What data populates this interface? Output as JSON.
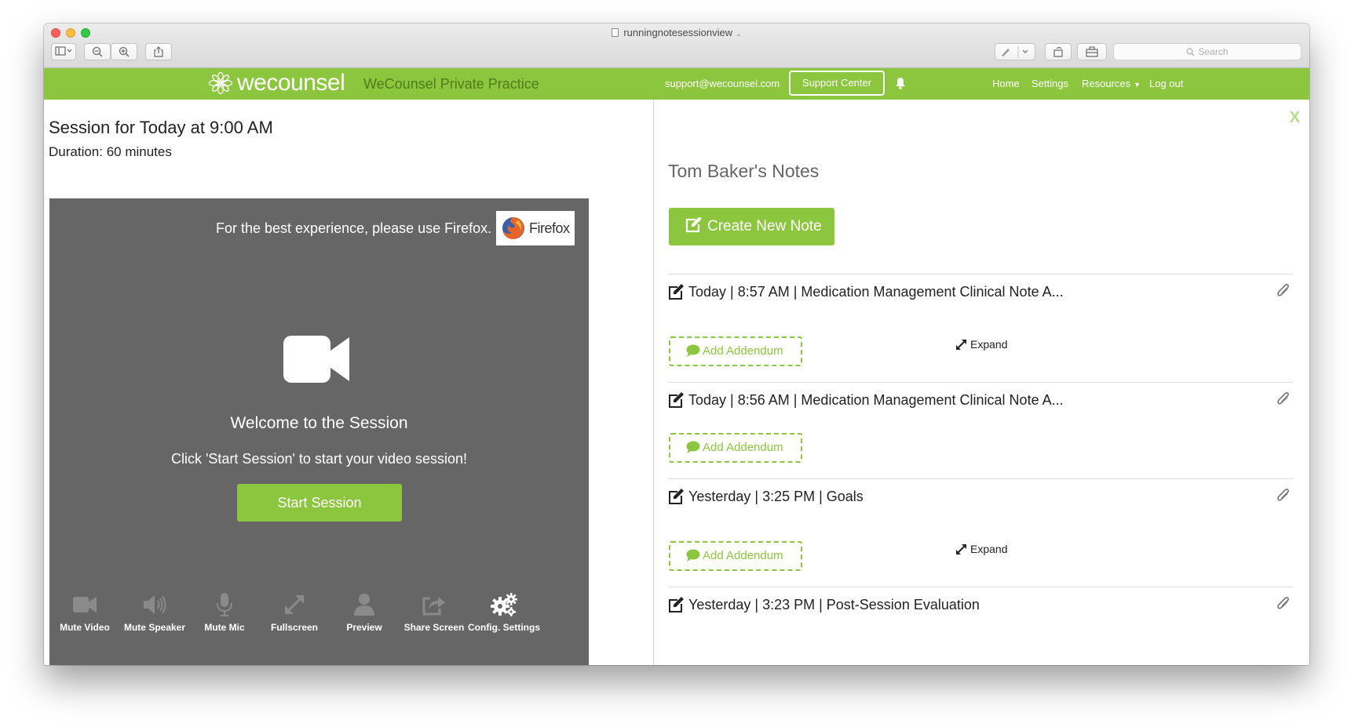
{
  "browser": {
    "doc_title": "runningnotesessionview",
    "search_placeholder": "Search"
  },
  "header": {
    "logo_text": "wecounsel",
    "practice_name": "WeCounsel Private Practice",
    "support_email": "support@wecounsel.com",
    "support_center": "Support Center",
    "nav": [
      {
        "label": "Home"
      },
      {
        "label": "Settings"
      },
      {
        "label": "Resources"
      },
      {
        "label": "Log out"
      }
    ],
    "brand_color": "#8cc63f"
  },
  "session": {
    "title": "Session for Today at 9:00 AM",
    "duration": "Duration: 60 minutes",
    "firefox_note": "For the best experience, please use Firefox.",
    "firefox_badge": "Firefox",
    "welcome": "Welcome to the Session",
    "instruction": "Click 'Start Session' to start your video session!",
    "start_button": "Start Session",
    "controls": [
      {
        "label": "Mute Video",
        "icon": "video-camera-icon"
      },
      {
        "label": "Mute Speaker",
        "icon": "speaker-icon"
      },
      {
        "label": "Mute Mic",
        "icon": "microphone-icon"
      },
      {
        "label": "Fullscreen",
        "icon": "fullscreen-arrows-icon"
      },
      {
        "label": "Preview",
        "icon": "user-icon"
      },
      {
        "label": "Share Screen",
        "icon": "share-icon"
      },
      {
        "label": "Config. Settings",
        "icon": "gears-icon"
      }
    ]
  },
  "notes": {
    "close": "X",
    "title": "Tom Baker's Notes",
    "create_button": "Create New Note",
    "items": [
      {
        "heading": "Today | 8:57 AM | Medication Management Clinical Note A...",
        "addendum": "Add Addendum",
        "expand": "Expand"
      },
      {
        "heading": "Today | 8:56 AM | Medication Management Clinical Note A...",
        "addendum": "Add Addendum",
        "expand": ""
      },
      {
        "heading": "Yesterday | 3:25 PM | Goals",
        "addendum": "Add Addendum",
        "expand": "Expand"
      },
      {
        "heading": "Yesterday | 3:23 PM | Post-Session Evaluation",
        "addendum": "",
        "expand": ""
      }
    ]
  }
}
